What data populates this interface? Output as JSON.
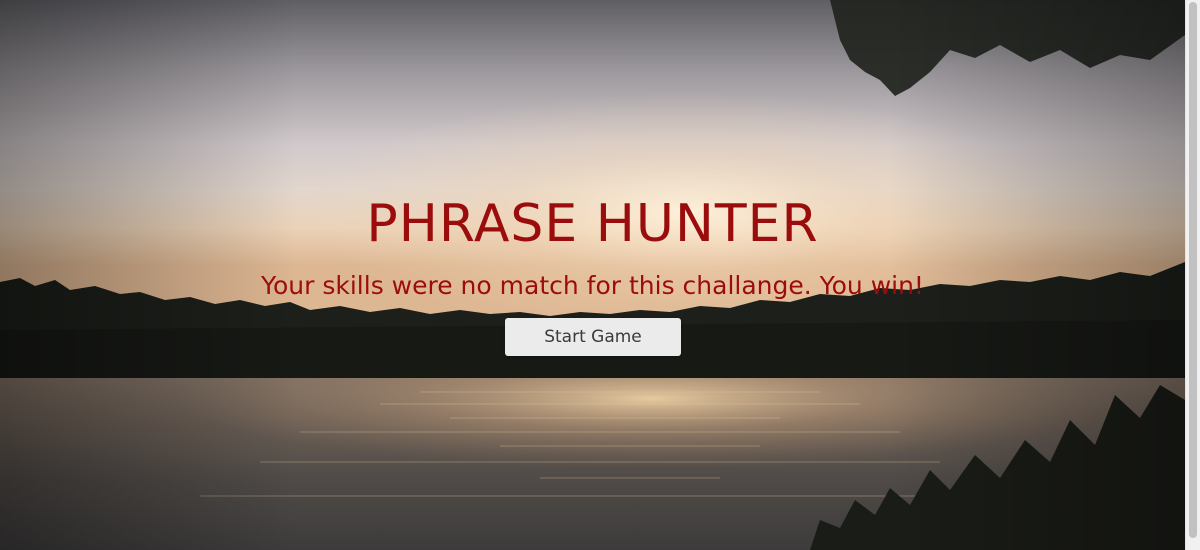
{
  "game": {
    "title": "PHRASE HUNTER",
    "message": "Your skills were no match for this challange. You win!",
    "start_button_label": "Start Game"
  },
  "colors": {
    "title": "#9b0d0d",
    "message": "#9b0d0d",
    "button_bg": "#ebebeb",
    "button_text": "#3a3a3a",
    "scrollbar_track": "#f1f1f1",
    "scrollbar_thumb": "#c1c1c1"
  },
  "background": {
    "scene": "sunset over lake with treeline",
    "icon": "lake-sunset-photo"
  }
}
